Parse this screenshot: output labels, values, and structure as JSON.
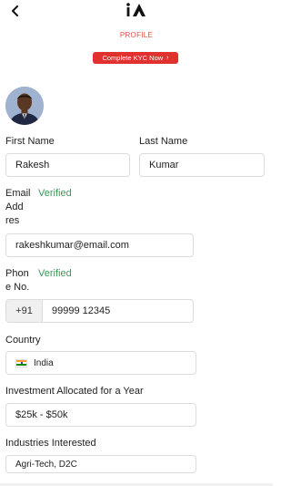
{
  "header": {
    "title": "PROFILE",
    "kyc_button": "Complete KYC Now",
    "kyc_arrow": "›"
  },
  "form": {
    "first_name": {
      "label": "First Name",
      "value": "Rakesh"
    },
    "last_name": {
      "label": "Last Name",
      "value": "Kumar"
    },
    "email": {
      "label_lines": [
        "Email",
        "Add",
        "res"
      ],
      "status": "Verified",
      "value": "rakeshkumar@email.com"
    },
    "phone": {
      "label_lines": [
        "Phon",
        "e No."
      ],
      "status": "Verified",
      "country_code": "+91",
      "value": "99999 12345"
    },
    "country": {
      "label": "Country",
      "value": "India",
      "flag": "india-flag-icon"
    },
    "investment": {
      "label": "Investment Allocated for a Year",
      "value": "$25k - $50k"
    },
    "industries": {
      "label": "Industries Interested",
      "value": "Agri-Tech, D2C"
    }
  },
  "colors": {
    "accent_red": "#e0312f",
    "verified_green": "#3a9a58",
    "title_red": "#e2504a"
  }
}
